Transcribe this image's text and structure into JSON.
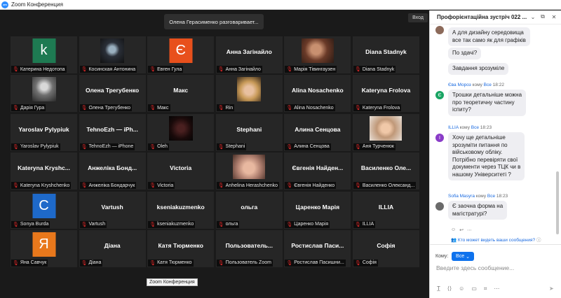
{
  "window": {
    "title": "Zoom Конференция",
    "logo_text": "zm"
  },
  "meeting": {
    "speaker_banner": "Олена Герасименко разговаривает...",
    "exit_label": "Вход",
    "tooltip": "Zoom Конференция",
    "tiles": [
      {
        "kind": "letter",
        "letter": "k",
        "color": "#1e7a52",
        "label": "Катерина Недотопа"
      },
      {
        "kind": "photo",
        "photo": "dark-figure",
        "label": "Косинская Антонина"
      },
      {
        "kind": "letter",
        "letter": "Є",
        "color": "#e8501c",
        "label": "Евген Гула"
      },
      {
        "kind": "text",
        "big": "Анна Загінайло",
        "label": "Анна Загінайло"
      },
      {
        "kind": "photo",
        "photo": "brown-face",
        "label": "Марія Тівингаузен"
      },
      {
        "kind": "text",
        "big": "Diana Stadnyk",
        "label": "Diana Stadnyk"
      },
      {
        "kind": "photo",
        "photo": "bw-portrait",
        "label": "Дарія Гура"
      },
      {
        "kind": "text",
        "big": "Олена Трегубенко",
        "label": "Олена Трегубенко"
      },
      {
        "kind": "text",
        "big": "Макс",
        "label": "Макс"
      },
      {
        "kind": "photo",
        "photo": "blond-face",
        "label": "Rin"
      },
      {
        "kind": "text",
        "big": "Alina Nosachenko",
        "label": "Alina Nosachenko"
      },
      {
        "kind": "text",
        "big": "Kateryna Frolova",
        "label": "Kateryna Frolova"
      },
      {
        "kind": "text",
        "big": "Yaroslav Pylypiuk",
        "label": "Yaroslav Pylypiuk"
      },
      {
        "kind": "text",
        "big": "TehnoEzh — iPh...",
        "label": "TehnoEzh — iPhone"
      },
      {
        "kind": "photo",
        "photo": "dark-red",
        "label": "Oleh"
      },
      {
        "kind": "text",
        "big": "Stephani",
        "label": "Stephani"
      },
      {
        "kind": "text",
        "big": "Алина Сенцова",
        "label": "Алина Сенцова"
      },
      {
        "kind": "photo",
        "photo": "smile-face",
        "label": "Аня Турченюк"
      },
      {
        "kind": "text",
        "big": "Kateryna Kryshc...",
        "label": "Kateryna Kryshchenko"
      },
      {
        "kind": "text",
        "big": "Анжеліка Бонд...",
        "label": "Анжеліка Бондарчук"
      },
      {
        "kind": "text",
        "big": "Victoria",
        "label": "Victoria"
      },
      {
        "kind": "photo",
        "photo": "eyes-face",
        "label": "Anhelina Herashchenko"
      },
      {
        "kind": "text",
        "big": "Євгенія Найден...",
        "label": "Євгенія Найденко"
      },
      {
        "kind": "text",
        "big": "Василенко Оле...",
        "label": "Василенко Олександ..."
      },
      {
        "kind": "letter",
        "letter": "C",
        "color": "#1e69c9",
        "label": "Sonya Burda"
      },
      {
        "kind": "text",
        "big": "Vartush",
        "label": "Vartush"
      },
      {
        "kind": "text",
        "big": "kseniakuzmenko",
        "label": "kseniakuzmenko"
      },
      {
        "kind": "text",
        "big": "ольга",
        "label": "ольга"
      },
      {
        "kind": "text",
        "big": "Царенко Марія",
        "label": "Царенко Марія"
      },
      {
        "kind": "text",
        "big": "ILLIA",
        "label": "ILLIA"
      },
      {
        "kind": "letter",
        "letter": "Я",
        "color": "#e8781c",
        "label": "Яна Савчук"
      },
      {
        "kind": "text",
        "big": "Діана",
        "label": "Діана"
      },
      {
        "kind": "text",
        "big": "Катя Тюрменко",
        "label": "Катя Тюрменко"
      },
      {
        "kind": "text",
        "big": "Пользователь...",
        "label": "Пользователь Zoom"
      },
      {
        "kind": "text",
        "big": "Ростислав Паси...",
        "label": "Ростислав Пасишни..."
      },
      {
        "kind": "text",
        "big": "Софія",
        "label": "Софія"
      }
    ]
  },
  "chat": {
    "title": "Профорієнтаційна зустріч 022 ...",
    "messages": {
      "m1_line1": "А для дизайну середовища",
      "m1_line2": "все так само як для графіків",
      "m2": "По здачі?",
      "m3": "Завдання зрозуміле",
      "s4_name": "Єва Мороз",
      "s4_to": "кому",
      "s4_all": "Все",
      "s4_time": "18:22",
      "m4_line1": "Трошки детальніше можна",
      "m4_line2": "про теоретичну частину",
      "m4_line3": "іспиту?",
      "av4_letter": "Є",
      "s5_name": "ILLIA",
      "s5_to": "кому",
      "s5_all": "Все",
      "s5_time": "18:23",
      "av5_letter": "I",
      "m5_line1": "Хочу ще детальніше",
      "m5_line2": "зрозуміти питання по",
      "m5_line3": "військовому обліку.",
      "m5_line4": "Потрібно перевіряти свої",
      "m5_line5": "документи через ТЦК чи в",
      "m5_line6": "нашому Університеті ?",
      "s6_name": "Sofia Masyra",
      "s6_to": "кому",
      "s6_all": "Все",
      "s6_time": "18:23",
      "m6_line1": "Є заочна форма на",
      "m6_line2": "магістратурі?"
    },
    "who_can_see": "Кто может видеть ваши сообщения?",
    "to_label": "Кому:",
    "to_value": "Все",
    "input_placeholder": "Введите здесь сообщение..."
  },
  "colors": {
    "accent": "#0e72ed",
    "mic_muted": "#e02828",
    "tile_bg": "#262626"
  }
}
